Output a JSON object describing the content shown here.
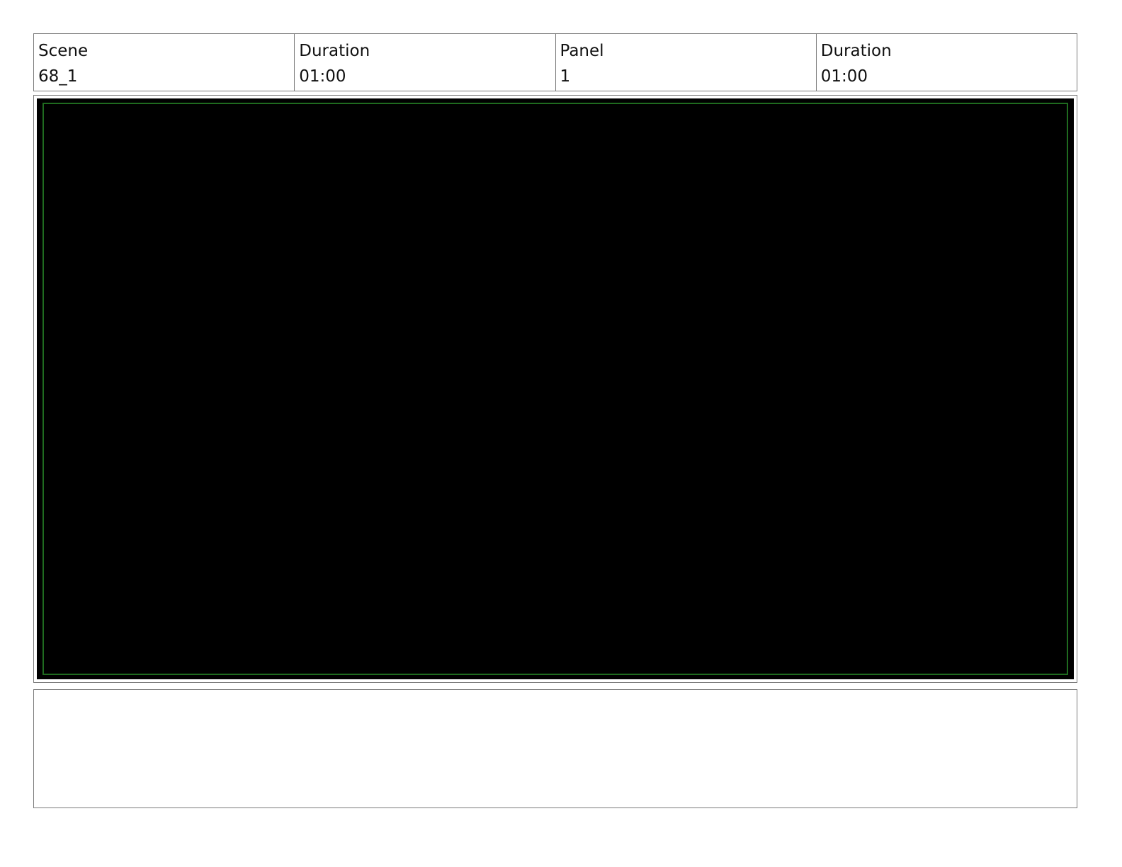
{
  "header": {
    "scene": {
      "label": "Scene",
      "value": "68_1"
    },
    "scene_duration": {
      "label": "Duration",
      "value": "01:00"
    },
    "panel": {
      "label": "Panel",
      "value": "1"
    },
    "panel_duration": {
      "label": "Duration",
      "value": "01:00"
    }
  },
  "panel_frame": {
    "background_color": "#000000",
    "safe_area_color": "#1f6b1f"
  },
  "notes": {
    "text": ""
  }
}
